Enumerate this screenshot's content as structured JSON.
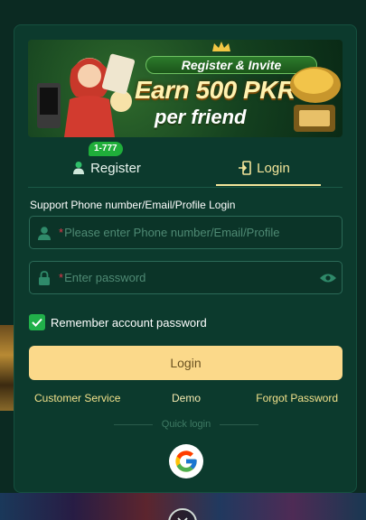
{
  "banner": {
    "headline": "Register & Invite",
    "earn": "Earn 500 PKR",
    "per_friend": "per friend"
  },
  "tabs": {
    "register_label": "Register",
    "register_badge": "1-777",
    "login_label": "Login"
  },
  "form": {
    "support_text": "Support Phone number/Email/Profile Login",
    "phone_placeholder": "Please enter Phone number/Email/Profile",
    "password_placeholder": "Enter password",
    "required_mark": "*",
    "remember_label": "Remember account password",
    "remember_checked": true,
    "login_button": "Login"
  },
  "links": {
    "customer_service": "Customer Service",
    "demo": "Demo",
    "forgot_password": "Forgot Password"
  },
  "quick_login": {
    "label": "Quick login",
    "providers": [
      "google-icon"
    ]
  },
  "colors": {
    "modal_bg": "#0c3a2d",
    "accent_gold": "#fbd98a",
    "active_tab": "#f3e59a",
    "required_red": "#e0374b",
    "checkbox_green": "#21b04a"
  }
}
